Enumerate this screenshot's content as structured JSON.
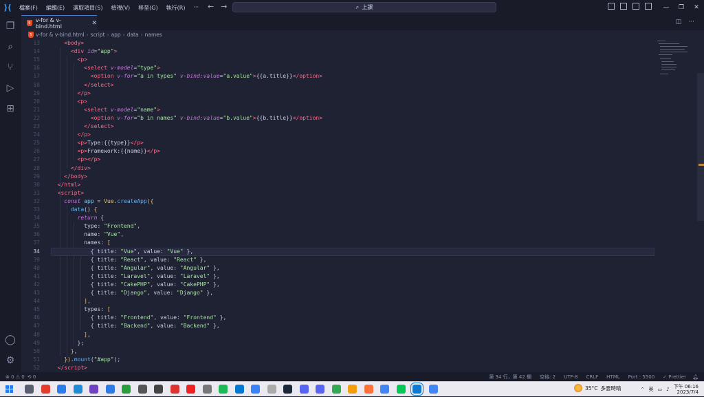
{
  "titlebar": {
    "menus": [
      "檔案(F)",
      "編輯(E)",
      "選取項目(S)",
      "檢視(V)",
      "移至(G)",
      "執行(R)",
      "···"
    ],
    "search_text": "上課"
  },
  "tab": {
    "name": "v-for & v-bind.html"
  },
  "breadcrumb": [
    "v-for & v-bind.html",
    "script",
    "app",
    "data",
    "names"
  ],
  "editor": {
    "lines": [
      {
        "n": "13",
        "html": "    <span class='t'>&lt;body&gt;</span>"
      },
      {
        "n": "14",
        "html": "      <span class='t'>&lt;div</span> <span class='a'>id</span><span class='p'>=</span><span class='s'>\"app\"</span><span class='t'>&gt;</span>"
      },
      {
        "n": "15",
        "html": "        <span class='t'>&lt;p&gt;</span>"
      },
      {
        "n": "16",
        "html": "          <span class='t'>&lt;select</span> <span class='a'>v-model</span><span class='p'>=</span><span class='s'>\"type\"</span><span class='t'>&gt;</span>"
      },
      {
        "n": "17",
        "html": "            <span class='t'>&lt;option</span> <span class='a'>v-for</span><span class='p'>=</span><span class='s'>\"a in types\"</span> <span class='a'>v-bind:value</span><span class='p'>=</span><span class='s'>\"a.value\"</span><span class='t'>&gt;</span><span class='p'>{{a.title}}</span><span class='t'>&lt;/option&gt;</span>"
      },
      {
        "n": "18",
        "html": "          <span class='t'>&lt;/select&gt;</span>"
      },
      {
        "n": "19",
        "html": "        <span class='t'>&lt;/p&gt;</span>"
      },
      {
        "n": "20",
        "html": "        <span class='t'>&lt;p&gt;</span>"
      },
      {
        "n": "21",
        "html": "          <span class='t'>&lt;select</span> <span class='a'>v-model</span><span class='p'>=</span><span class='s'>\"name\"</span><span class='t'>&gt;</span>"
      },
      {
        "n": "22",
        "html": "            <span class='t'>&lt;option</span> <span class='a'>v-for</span><span class='p'>=</span><span class='s'>\"b in names\"</span> <span class='a'>v-bind:value</span><span class='p'>=</span><span class='s'>\"b.value\"</span><span class='t'>&gt;</span><span class='p'>{{b.title}}</span><span class='t'>&lt;/option&gt;</span>"
      },
      {
        "n": "23",
        "html": "          <span class='t'>&lt;/select&gt;</span>"
      },
      {
        "n": "24",
        "html": "        <span class='t'>&lt;/p&gt;</span>"
      },
      {
        "n": "25",
        "html": "        <span class='t'>&lt;p&gt;</span><span class='p'>Type:{{type}}</span><span class='t'>&lt;/p&gt;</span>"
      },
      {
        "n": "26",
        "html": "        <span class='t'>&lt;p&gt;</span><span class='p'>Framework:{{name}}</span><span class='t'>&lt;/p&gt;</span>"
      },
      {
        "n": "27",
        "html": "        <span class='t'>&lt;p&gt;&lt;/p&gt;</span>"
      },
      {
        "n": "28",
        "html": "      <span class='t'>&lt;/div&gt;</span>"
      },
      {
        "n": "29",
        "html": "    <span class='t'>&lt;/body&gt;</span>"
      },
      {
        "n": "30",
        "html": "  <span class='t'>&lt;/html&gt;</span>"
      },
      {
        "n": "31",
        "html": "  <span class='t'>&lt;script&gt;</span>"
      },
      {
        "n": "32",
        "html": "    <span class='k'>const</span> <span class='pp'>app</span> <span class='p'>=</span> <span class='y'>Vue</span><span class='p'>.</span><span class='f'>createApp</span><span class='y'>({</span>"
      },
      {
        "n": "33",
        "html": "      <span class='f'>data</span><span class='p'>()</span> <span class='y'>{</span>"
      },
      {
        "n": "34",
        "html": "        <span class='k'>return</span> <span class='p'>{</span>"
      },
      {
        "n": "35",
        "html": "          <span class='p'>type:</span> <span class='s'>\"Frontend\"</span><span class='p'>,</span>"
      },
      {
        "n": "36",
        "html": "          <span class='p'>name:</span> <span class='s'>\"Vue\"</span><span class='p'>,</span>"
      },
      {
        "n": "37",
        "html": "          <span class='p'>names:</span> <span class='y'>[</span>"
      },
      {
        "n": "34",
        "html": "            <span class='p'>{ title:</span> <span class='s'>\"Vue\"</span><span class='p'>, value:</span> <span class='s'>\"Vue\"</span> <span class='p'>},</span>",
        "active": true
      },
      {
        "n": "39",
        "html": "            <span class='p'>{ title:</span> <span class='s'>\"React\"</span><span class='p'>, value:</span> <span class='s'>\"React\"</span> <span class='p'>},</span>"
      },
      {
        "n": "40",
        "html": "            <span class='p'>{ title:</span> <span class='s'>\"Angular\"</span><span class='p'>, value:</span> <span class='s'>\"Angular\"</span> <span class='p'>},</span>"
      },
      {
        "n": "41",
        "html": "            <span class='p'>{ title:</span> <span class='s'>\"Laravel\"</span><span class='p'>, value:</span> <span class='s'>\"Laravel\"</span> <span class='p'>},</span>"
      },
      {
        "n": "42",
        "html": "            <span class='p'>{ title:</span> <span class='s'>\"CakePHP\"</span><span class='p'>, value:</span> <span class='s'>\"CakePHP\"</span> <span class='p'>},</span>"
      },
      {
        "n": "43",
        "html": "            <span class='p'>{ title:</span> <span class='s'>\"Django\"</span><span class='p'>, value:</span> <span class='s'>\"Django\"</span> <span class='p'>},</span>"
      },
      {
        "n": "44",
        "html": "          <span class='y'>]</span><span class='p'>,</span>"
      },
      {
        "n": "45",
        "html": "          <span class='p'>types:</span> <span class='y'>[</span>"
      },
      {
        "n": "46",
        "html": "            <span class='p'>{ title:</span> <span class='s'>\"Frontend\"</span><span class='p'>, value:</span> <span class='s'>\"Frontend\"</span> <span class='p'>},</span>"
      },
      {
        "n": "47",
        "html": "            <span class='p'>{ title:</span> <span class='s'>\"Backend\"</span><span class='p'>, value:</span> <span class='s'>\"Backend\"</span> <span class='p'>},</span>"
      },
      {
        "n": "48",
        "html": "          <span class='y'>]</span><span class='p'>,</span>"
      },
      {
        "n": "49",
        "html": "        <span class='p'>};</span>"
      },
      {
        "n": "50",
        "html": "      <span class='y'>}</span><span class='p'>,</span>"
      },
      {
        "n": "51",
        "html": "    <span class='y'>})</span><span class='p'>.</span><span class='f'>mount</span><span class='p'>(</span><span class='s'>\"#app\"</span><span class='p'>);</span>"
      },
      {
        "n": "52",
        "html": "  <span class='t'>&lt;/script&gt;</span>"
      }
    ]
  },
  "statusbar": {
    "errors": "⊗ 0 ⚠ 0",
    "sync": "⟲ 0",
    "position": "第 34 行，第 42 欄",
    "spaces": "空格: 2",
    "encoding": "UTF-8",
    "eol": "CRLF",
    "language": "HTML",
    "port": "Port : 5500",
    "prettier": "✓ Prettier"
  },
  "taskbar": {
    "temperature": "35°C",
    "weather": "多雲時晴",
    "ime": "英",
    "time": "下午 06:16",
    "date": "2023/7/4"
  },
  "colors": {
    "accent": "#4b7bd1",
    "editor_bg": "#1f2233",
    "bar_bg": "#191b29"
  }
}
